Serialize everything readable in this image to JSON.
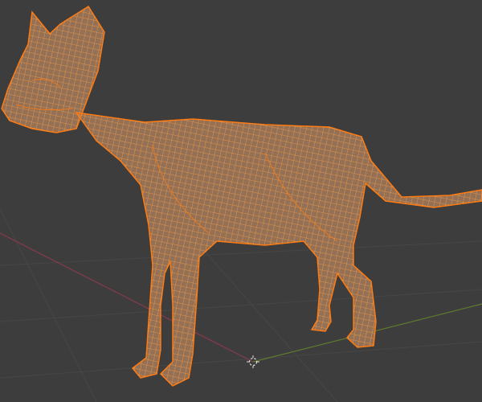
{
  "viewport": {
    "mode": "3d-viewport",
    "object": "cat-mesh-wireframe",
    "colors": {
      "background": "#3d3d3d",
      "grid": "#474747",
      "x_axis": "#8a3a4a",
      "y_axis": "#5d7a2e",
      "mesh_fill": "#a37a5a",
      "wire": "#ffa040",
      "wire_active": "#ff7a10",
      "cursor": "#e0e0e0"
    }
  }
}
